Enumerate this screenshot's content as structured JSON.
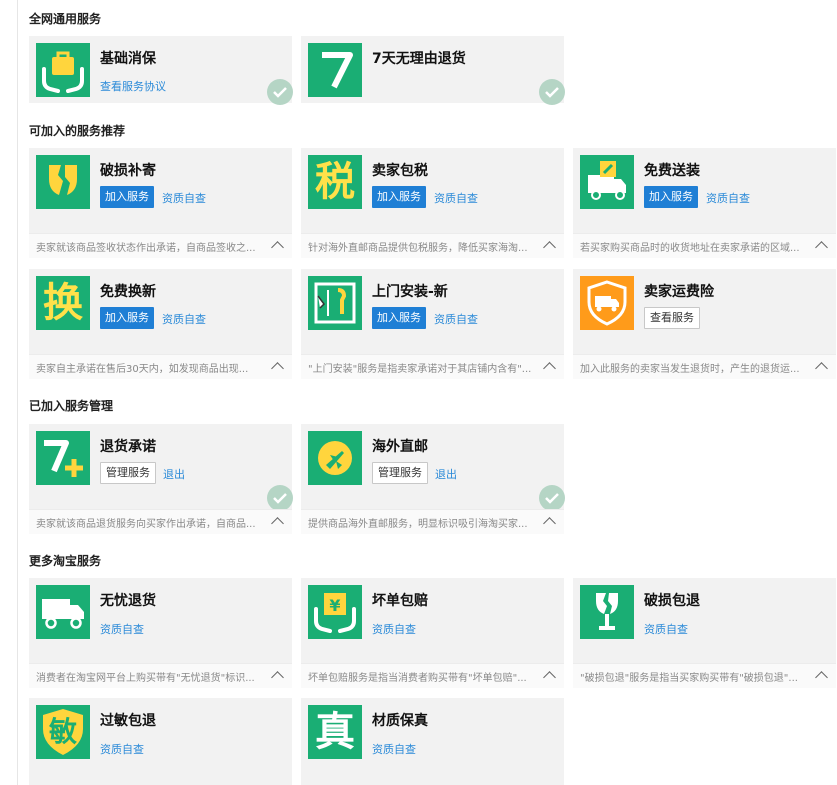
{
  "sections": {
    "general": "全网通用服务",
    "recommended": "可加入的服务推荐",
    "joined": "已加入服务管理",
    "more": "更多淘宝服务"
  },
  "general": [
    {
      "name": "基础消保",
      "link": "查看服务协议",
      "icon": "shopping-bag-hands-icon"
    },
    {
      "name": "7天无理由退货",
      "icon": "seven-days-icon"
    }
  ],
  "recommended": [
    {
      "name": "破损补寄",
      "button": "加入服务",
      "link": "资质自查",
      "desc": "卖家就该商品签收状态作出承诺，自商品签收之...",
      "icon": "broken-cup-icon"
    },
    {
      "name": "卖家包税",
      "button": "加入服务",
      "link": "资质自查",
      "desc": "针对海外直邮商品提供包税服务，降低买家海淘...",
      "icon": "tax-icon",
      "glyph": "税"
    },
    {
      "name": "免费送装",
      "button": "加入服务",
      "link": "资质自查",
      "desc": "若买家购买商品时的收货地址在卖家承诺的区域...",
      "icon": "truck-wrench-icon"
    },
    {
      "name": "免费换新",
      "button": "加入服务",
      "link": "资质自查",
      "desc": "卖家自主承诺在售后30天内，如发现商品出现...",
      "icon": "exchange-icon",
      "glyph": "换"
    },
    {
      "name": "上门安装-新",
      "button": "加入服务",
      "link": "资质自查",
      "desc": "\"上门安装\"服务是指卖家承诺对于其店铺内含有\"...",
      "icon": "door-wrench-icon"
    },
    {
      "name": "卖家运费险",
      "button": "查看服务",
      "desc": "加入此服务的卖家当发生退货时，产生的退货运...",
      "icon": "shipping-insurance-icon"
    }
  ],
  "joined": [
    {
      "name": "退货承诺",
      "button": "管理服务",
      "link": "退出",
      "desc": "卖家就该商品退货服务向买家作出承诺，自商品...",
      "icon": "seven-plus-icon"
    },
    {
      "name": "海外直邮",
      "button": "管理服务",
      "link": "退出",
      "desc": "提供商品海外直邮服务，明显标识吸引海淘买家...",
      "icon": "airplane-icon"
    }
  ],
  "more": [
    {
      "name": "无忧退货",
      "link": "资质自查",
      "desc": "消费者在淘宝网平台上购买带有\"无忧退货\"标识...",
      "icon": "delivery-truck-icon"
    },
    {
      "name": "坏单包赔",
      "link": "资质自查",
      "desc": "坏单包赔服务是指当消费者购买带有\"坏单包赔\"...",
      "icon": "yuan-hands-icon"
    },
    {
      "name": "破损包退",
      "link": "资质自查",
      "desc": "\"破损包退\"服务是指当买家购买带有\"破损包退\"...",
      "icon": "broken-glass-icon"
    },
    {
      "name": "过敏包退",
      "link": "资质自查",
      "icon": "allergy-shield-icon",
      "glyph": "敏"
    },
    {
      "name": "材质保真",
      "link": "资质自查",
      "icon": "authentic-icon",
      "glyph": "真"
    }
  ],
  "colors": {
    "green": "#1aae74",
    "orange": "#ff9b1a",
    "blue": "#1f7fd5",
    "link": "#2a8ad8",
    "card": "#f2f2f2"
  }
}
